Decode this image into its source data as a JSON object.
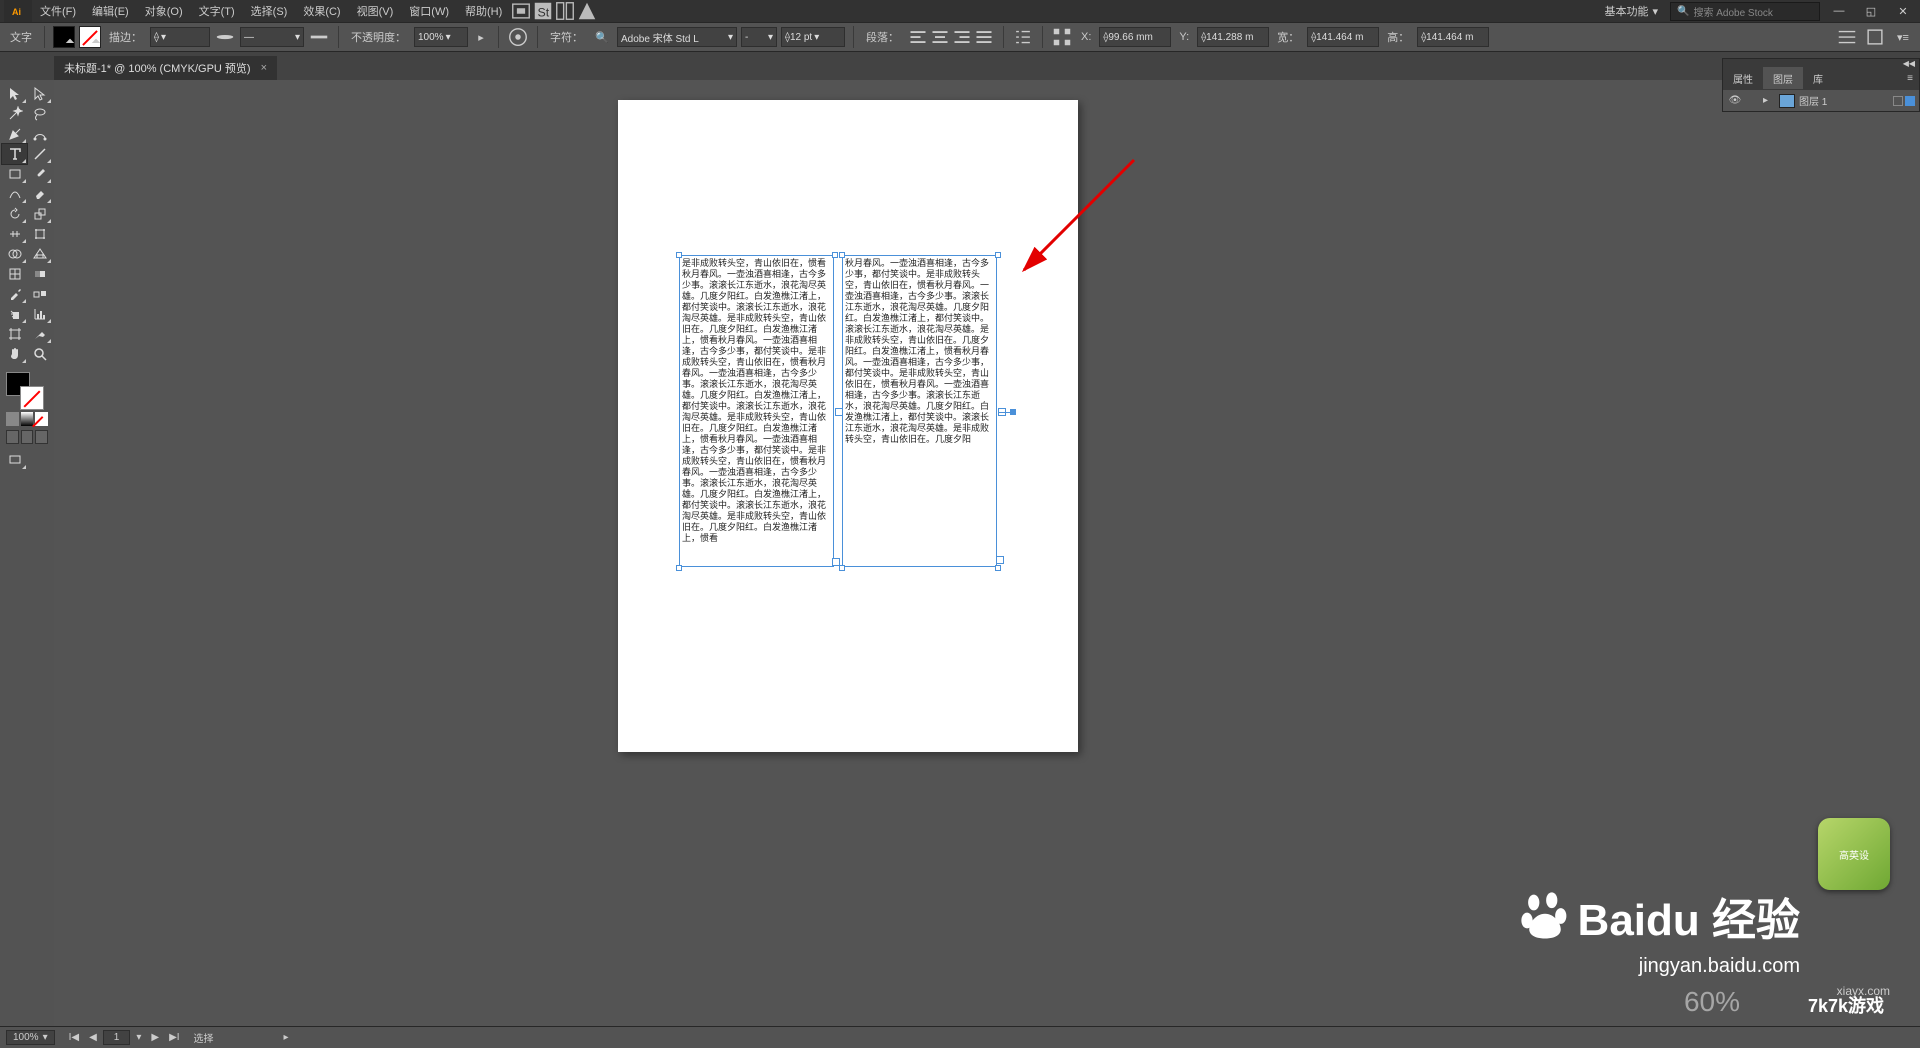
{
  "menu": {
    "items": [
      "文件(F)",
      "编辑(E)",
      "对象(O)",
      "文字(T)",
      "选择(S)",
      "效果(C)",
      "视图(V)",
      "窗口(W)",
      "帮助(H)"
    ],
    "workspace": "基本功能",
    "search_placeholder": "搜索 Adobe Stock"
  },
  "control": {
    "tool_label": "文字",
    "stroke_label": "描边：",
    "stroke_width": "",
    "opacity_label": "不透明度：",
    "opacity_value": "100%",
    "char_label": "字符：",
    "font_name": "Adobe 宋体 Std L",
    "font_style": "-",
    "font_size": "12 pt",
    "para_label": "段落：",
    "x_label": "X:",
    "x_value": "99.66 mm",
    "y_label": "Y:",
    "y_value": "141.288 m",
    "w_label": "宽：",
    "w_value": "141.464 m",
    "h_label": "高：",
    "h_value": "141.464 m"
  },
  "doc_tab": {
    "title": "未标题-1* @ 100% (CMYK/GPU 预览)"
  },
  "panel": {
    "tabs": [
      "属性",
      "图层",
      "库"
    ],
    "active": 1,
    "layer_name": "图层 1"
  },
  "status": {
    "zoom": "100%",
    "page": "1",
    "hint": "选择"
  },
  "text_columns": {
    "col1": "是非成败转头空，青山依旧在，惯看秋月春风。一壶浊酒喜相逢，古今多少事。滚滚长江东逝水，浪花淘尽英雄。几度夕阳红。白发渔樵江渚上，都付笑谈中。滚滚长江东逝水，浪花淘尽英雄。是非成败转头空，青山依旧在。几度夕阳红。白发渔樵江渚上，惯看秋月春风。一壶浊酒喜相逢，古今多少事，都付笑谈中。是非成败转头空，青山依旧在，惯看秋月春风。一壶浊酒喜相逢，古今多少事。滚滚长江东逝水，浪花淘尽英雄。几度夕阳红。白发渔樵江渚上，都付笑谈中。滚滚长江东逝水，浪花淘尽英雄。是非成败转头空，青山依旧在。几度夕阳红。白发渔樵江渚上，惯看秋月春风。一壶浊酒喜相逢，古今多少事，都付笑谈中。是非成败转头空，青山依旧在，惯看秋月春风。一壶浊酒喜相逢，古今多少事。滚滚长江东逝水，浪花淘尽英雄。几度夕阳红。白发渔樵江渚上，都付笑谈中。滚滚长江东逝水，浪花淘尽英雄。是非成败转头空，青山依旧在。几度夕阳红。白发渔樵江渚上，惯看",
    "col2": "秋月春风。一壶浊酒喜相逢，古今多少事，都付笑谈中。是非成败转头空，青山依旧在，惯看秋月春风。一壶浊酒喜相逢，古今多少事。滚滚长江东逝水，浪花淘尽英雄。几度夕阳红。白发渔樵江渚上，都付笑谈中。滚滚长江东逝水，浪花淘尽英雄。是非成败转头空，青山依旧在。几度夕阳红。白发渔樵江渚上，惯看秋月春风。一壶浊酒喜相逢，古今多少事，都付笑谈中。是非成败转头空，青山依旧在，惯看秋月春风。一壶浊酒喜相逢，古今多少事。滚滚长江东逝水，浪花淘尽英雄。几度夕阳红。白发渔樵江渚上，都付笑谈中。滚滚长江东逝水，浪花淘尽英雄。是非成败转头空，青山依旧在。几度夕阳"
  },
  "watermark": {
    "main": "Baidu 经验",
    "url": "jingyan.baidu.com",
    "zoom_pct": "60%",
    "side": "7k7k游戏",
    "side_url": "xiayx.com",
    "badge": "高英设"
  }
}
